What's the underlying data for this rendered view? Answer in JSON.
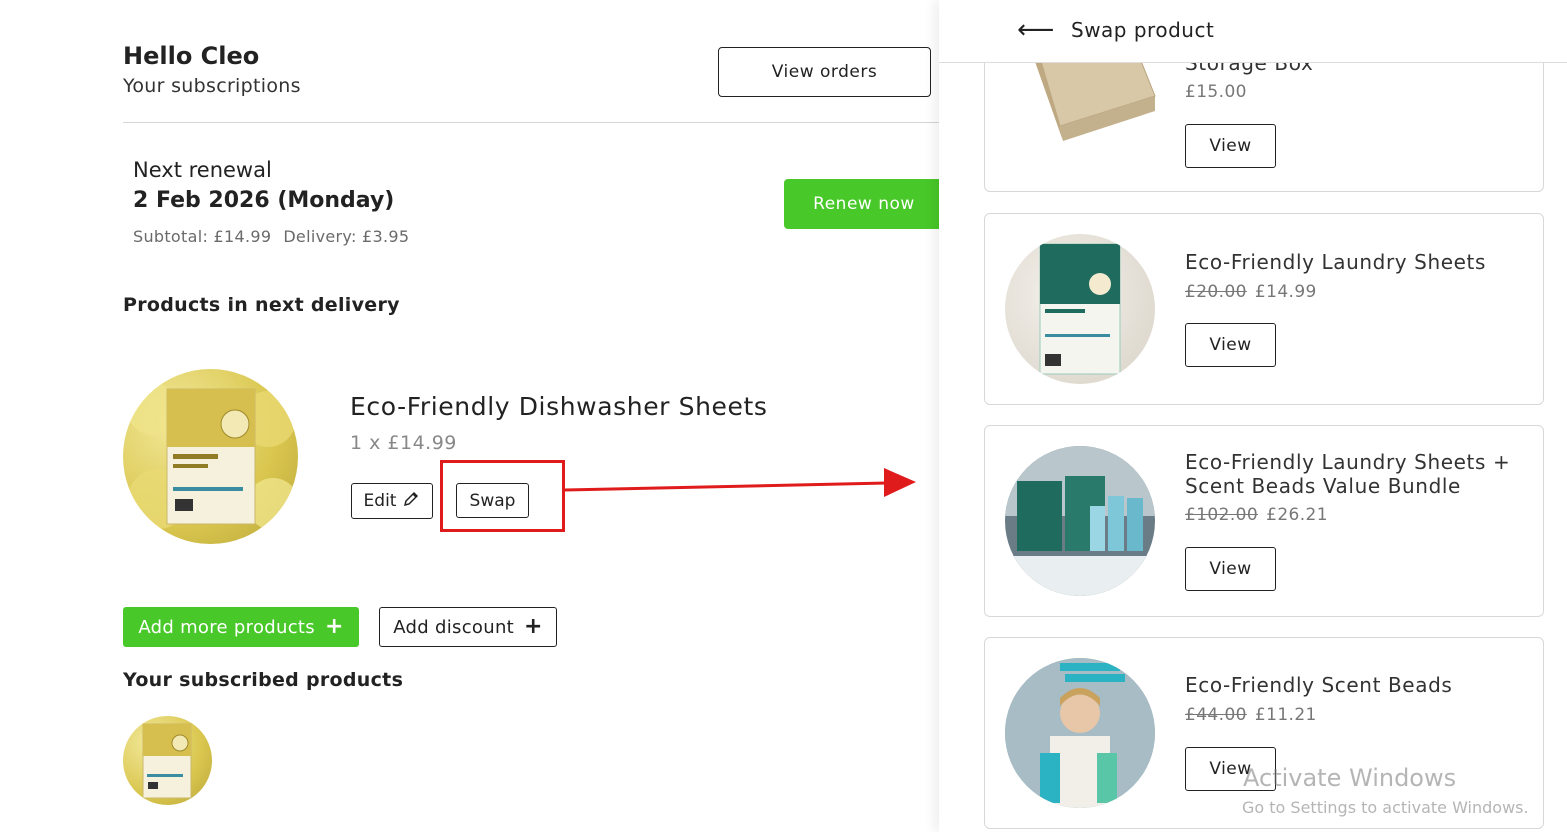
{
  "header": {
    "greeting": "Hello Cleo",
    "subtitle": "Your subscriptions",
    "view_orders_label": "View orders"
  },
  "renewal": {
    "label": "Next renewal",
    "date": "2 Feb 2026 (Monday)",
    "subtotal": "Subtotal: £14.99",
    "delivery": "Delivery: £3.95",
    "renew_label": "Renew now"
  },
  "next_delivery": {
    "title": "Products in next delivery",
    "product": {
      "name": "Eco-Friendly Dishwasher Sheets",
      "qty_price": "1 x £14.99",
      "edit_label": "Edit",
      "swap_label": "Swap"
    }
  },
  "actions": {
    "add_more_label": "Add more products",
    "add_discount_label": "Add discount"
  },
  "subscribed": {
    "title": "Your subscribed products"
  },
  "drawer": {
    "title": "Swap product",
    "cards": [
      {
        "name": "Storage Box",
        "old_price": "",
        "price": "£15.00",
        "view_label": "View"
      },
      {
        "name": "Eco-Friendly Laundry Sheets",
        "old_price": "£20.00",
        "price": "£14.99",
        "view_label": "View"
      },
      {
        "name": "Eco-Friendly Laundry Sheets + Scent Beads Value Bundle",
        "old_price": "£102.00",
        "price": "£26.21",
        "view_label": "View"
      },
      {
        "name": "Eco-Friendly Scent Beads",
        "old_price": "£44.00",
        "price": "£11.21",
        "view_label": "View"
      }
    ]
  },
  "watermark": {
    "line1": "Activate Windows",
    "line2": "Go to Settings to activate Windows."
  },
  "colors": {
    "accent_green": "#48c829",
    "highlight_red": "#e01b1b"
  }
}
